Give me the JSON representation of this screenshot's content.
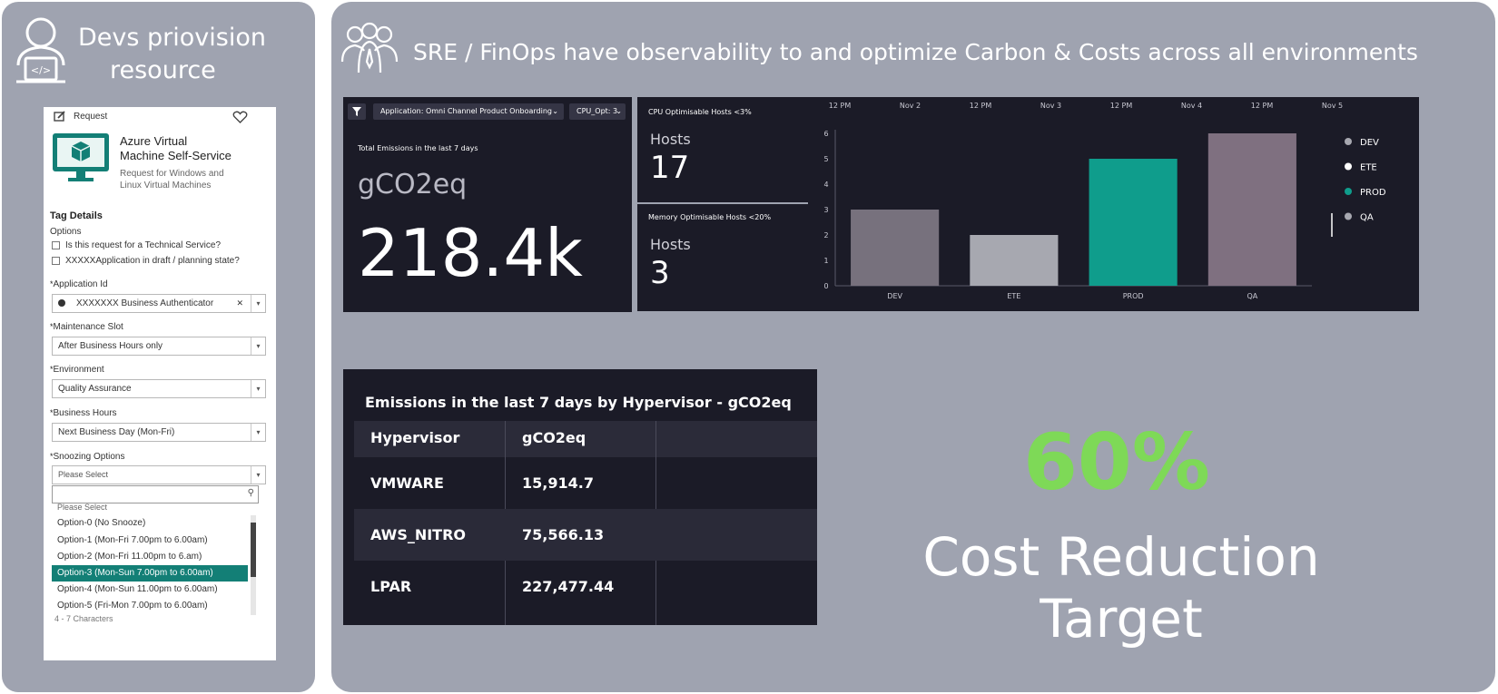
{
  "left_panel": {
    "heading_line1": "Devs priovision",
    "heading_line2": "resource"
  },
  "right_panel": {
    "heading": "SRE / FinOps have observability to and optimize Carbon & Costs across all environments"
  },
  "request_form": {
    "header_label": "Request",
    "title_line1": "Azure Virtual",
    "title_line2": "Machine Self-Service",
    "subtitle_line1": "Request for Windows and",
    "subtitle_line2": "Linux Virtual Machines",
    "tag_details": "Tag Details",
    "options_label": "Options",
    "checkbox1": "Is this request for a Technical Service?",
    "checkbox2": "XXXXXApplication in draft / planning state?",
    "application_id_label": "Application Id",
    "application_id_value": "XXXXXXX Business Authenticator",
    "maintenance_label": "Maintenance Slot",
    "maintenance_value": "After Business Hours only",
    "environment_label": "Environment",
    "environment_value": "Quality Assurance",
    "business_hours_label": "Business Hours",
    "business_hours_value": "Next Business Day (Mon-Fri)",
    "snoozing_label": "Snoozing Options",
    "snoozing_placeholder": "Please Select",
    "dropdown_options": [
      "Please Select",
      "Option-0 (No Snooze)",
      "Option-1 (Mon-Fri 7.00pm to 6.00am)",
      "Option-2 (Mon-Fri 11.00pm to 6.am)",
      "Option-3 (Mon-Sun 7.00pm to 6.00am)",
      "Option-4 (Mon-Sun 11.00pm to 6.00am)",
      "Option-5 (Fri-Mon 7.00pm to 6.00am)"
    ],
    "selected_option": "Option-3 (Mon-Sun 7.00pm to 6.00am)",
    "footer_text": "4 - 7 Characters"
  },
  "emissions_tile": {
    "filter_chip": "Application: Omni Channel Product Onboarding",
    "cpu_chip": "CPU_Opt: 3",
    "title": "Total Emissions in the last 7 days",
    "unit": "gCO2eq",
    "value": "218.4k"
  },
  "hosts_tile": {
    "cpu_title": "CPU Optimisable Hosts <3%",
    "cpu_label": "Hosts",
    "cpu_value": "17",
    "mem_title": "Memory Optimisable Hosts <20%",
    "mem_label": "Hosts",
    "mem_value": "3"
  },
  "timeline": {
    "labels": [
      "12 PM",
      "Nov 2",
      "12 PM",
      "Nov 3",
      "12 PM",
      "Nov 4",
      "12 PM",
      "Nov 5"
    ]
  },
  "chart_data": {
    "type": "bar",
    "categories": [
      "DEV",
      "ETE",
      "PROD",
      "QA"
    ],
    "values": [
      3,
      2,
      5,
      6
    ],
    "colors": [
      "#77717d",
      "#a7a8b0",
      "#0f9d8c",
      "#7f7080"
    ],
    "ylim": [
      0,
      6
    ],
    "yticks": [
      "0",
      "1",
      "2",
      "3",
      "4",
      "5",
      "6"
    ],
    "grid": false,
    "legend": [
      "DEV",
      "ETE",
      "PROD",
      "QA"
    ],
    "legend_position": "right",
    "legend_colors": [
      "#a7a8b0",
      "#ffffff",
      "#0f9d8c",
      "#a7a8b0"
    ],
    "title": "",
    "xlabel": "",
    "ylabel": ""
  },
  "table": {
    "title": "Emissions in the last 7 days by Hypervisor - gCO2eq",
    "headers": [
      "Hypervisor",
      "gCO2eq"
    ],
    "rows": [
      {
        "hypervisor": "VMWARE",
        "value": "15,914.7"
      },
      {
        "hypervisor": "AWS_NITRO",
        "value": "75,566.13"
      },
      {
        "hypervisor": "LPAR",
        "value": "227,477.44"
      }
    ]
  },
  "target": {
    "percent": "60%",
    "label": "Cost Reduction Target",
    "percent_color": "#7ed957"
  }
}
